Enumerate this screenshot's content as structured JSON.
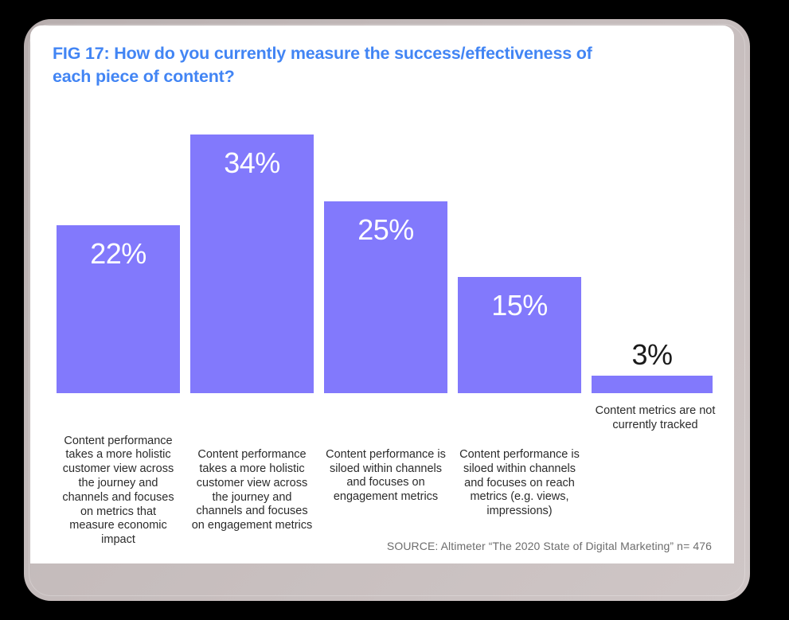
{
  "figure": {
    "title": "FIG 17: How do you currently measure the success/effectiveness of each piece of content?",
    "source": "SOURCE: Altimeter “The 2020 State of Digital Marketing” n= 476",
    "title_color": "#4285F4",
    "bar_color": "#8279FC",
    "inside_label_color": "#FFFFFF",
    "outside_label_color": "#1A1A1A",
    "card_background": "#FFFFFF",
    "frame_color": "#C4BBBB",
    "canvas_background": "#000000"
  },
  "chart_data": {
    "type": "bar",
    "title": "FIG 17: How do you currently measure the success/effectiveness of each piece of content?",
    "xlabel": "",
    "ylabel": "",
    "ylim": [
      0,
      40
    ],
    "grid": false,
    "legend": "none",
    "categories": [
      "Content performance takes a more holistic customer view across the journey and channels and focuses on metrics that measure economic impact",
      "Content performance takes a more holistic customer view across the journey and channels and focuses on engagement metrics",
      "Content performance is siloed within channels and focuses on engagement metrics",
      "Content performance is siloed within channels and focuses on reach metrics (e.g. views, impressions)",
      "Content metrics are not currently tracked"
    ],
    "values": [
      22,
      34,
      25,
      15,
      3
    ],
    "data_labels": [
      "22%",
      "34%",
      "25%",
      "15%",
      "3%"
    ],
    "label_placement": [
      "inside",
      "inside",
      "inside",
      "inside",
      "outside"
    ]
  }
}
